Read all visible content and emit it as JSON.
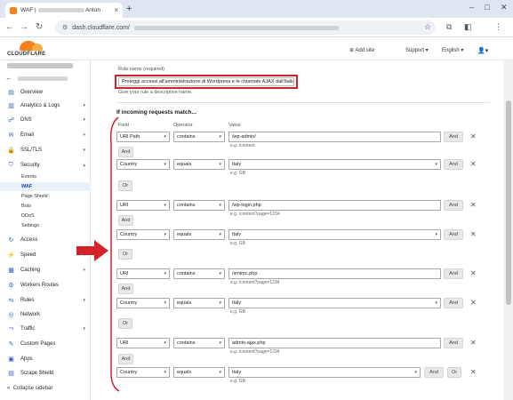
{
  "browser": {
    "tab_title": "WAF | ",
    "tab_title_suffix": "Anton",
    "url_host": "dash.cloudflare.com/",
    "new_tab": "+",
    "tab_close": "×",
    "window_minimize": "–",
    "window_maximize": "□",
    "window_close": "✕"
  },
  "header": {
    "logo_text": "CLOUDFLARE",
    "add_site": "Add site",
    "support": "Support",
    "language": "English"
  },
  "sidebar": {
    "items": [
      {
        "label": "Overview",
        "icon": "doc-icon"
      },
      {
        "label": "Analytics & Logs",
        "icon": "chart-icon"
      },
      {
        "label": "DNS",
        "icon": "network-icon"
      },
      {
        "label": "Email",
        "icon": "mail-icon"
      },
      {
        "label": "SSL/TLS",
        "icon": "lock-icon"
      },
      {
        "label": "Security",
        "icon": "shield-icon"
      }
    ],
    "security_sub": [
      "Events",
      "WAF",
      "Page Shield",
      "Bots",
      "DDoS",
      "Settings"
    ],
    "lower_items": [
      {
        "label": "Access",
        "icon": "access-icon"
      },
      {
        "label": "Speed",
        "icon": "speed-icon"
      },
      {
        "label": "Caching",
        "icon": "cache-icon"
      },
      {
        "label": "Workers Routes",
        "icon": "workers-icon"
      },
      {
        "label": "Rules",
        "icon": "rules-icon"
      },
      {
        "label": "Network",
        "icon": "network-icon"
      },
      {
        "label": "Traffic",
        "icon": "traffic-icon"
      },
      {
        "label": "Custom Pages",
        "icon": "pages-icon"
      },
      {
        "label": "Apps",
        "icon": "apps-icon"
      },
      {
        "label": "Scrape Shield",
        "icon": "scrape-icon"
      }
    ],
    "collapse": "Collapse sidebar"
  },
  "form": {
    "rule_name_label": "Rule name (required)",
    "rule_name_value": "Proteggi accessi all'amministrazione di Wordpress e le chiamate AJAX dall'Italia",
    "rule_name_hint": "Give your rule a descriptive name.",
    "section_title": "If incoming requests match...",
    "col_field": "Field",
    "col_operator": "Operator",
    "col_value": "Value",
    "and": "And",
    "or": "Or",
    "remove": "✕",
    "groups": [
      {
        "uri_field": "URI Path",
        "uri_op": "contains",
        "uri_value": "/wp-admin/",
        "uri_hint": "e.g. /content",
        "country_field": "Country",
        "country_op": "equals",
        "country_value": "Italy",
        "country_hint": "e.g. GB"
      },
      {
        "uri_field": "URI",
        "uri_op": "contains",
        "uri_value": "/wp-login.php",
        "uri_hint": "e.g. /content?page=1234",
        "country_field": "Country",
        "country_op": "equals",
        "country_value": "Italy",
        "country_hint": "e.g. GB"
      },
      {
        "uri_field": "URI",
        "uri_op": "contains",
        "uri_value": "/xmlrpc.php",
        "uri_hint": "e.g. /content?page=1234",
        "country_field": "Country",
        "country_op": "equals",
        "country_value": "Italy",
        "country_hint": "e.g. GB"
      },
      {
        "uri_field": "URI",
        "uri_op": "contains",
        "uri_value": "admin-ajax.php",
        "uri_hint": "e.g. /content?page=1234",
        "country_field": "Country",
        "country_op": "equals",
        "country_value": "Italy",
        "country_hint": "e.g. GB"
      }
    ]
  },
  "colors": {
    "accent": "#f6821f",
    "annotation_red": "#d2232a",
    "active_bg": "#eaf1fb"
  }
}
